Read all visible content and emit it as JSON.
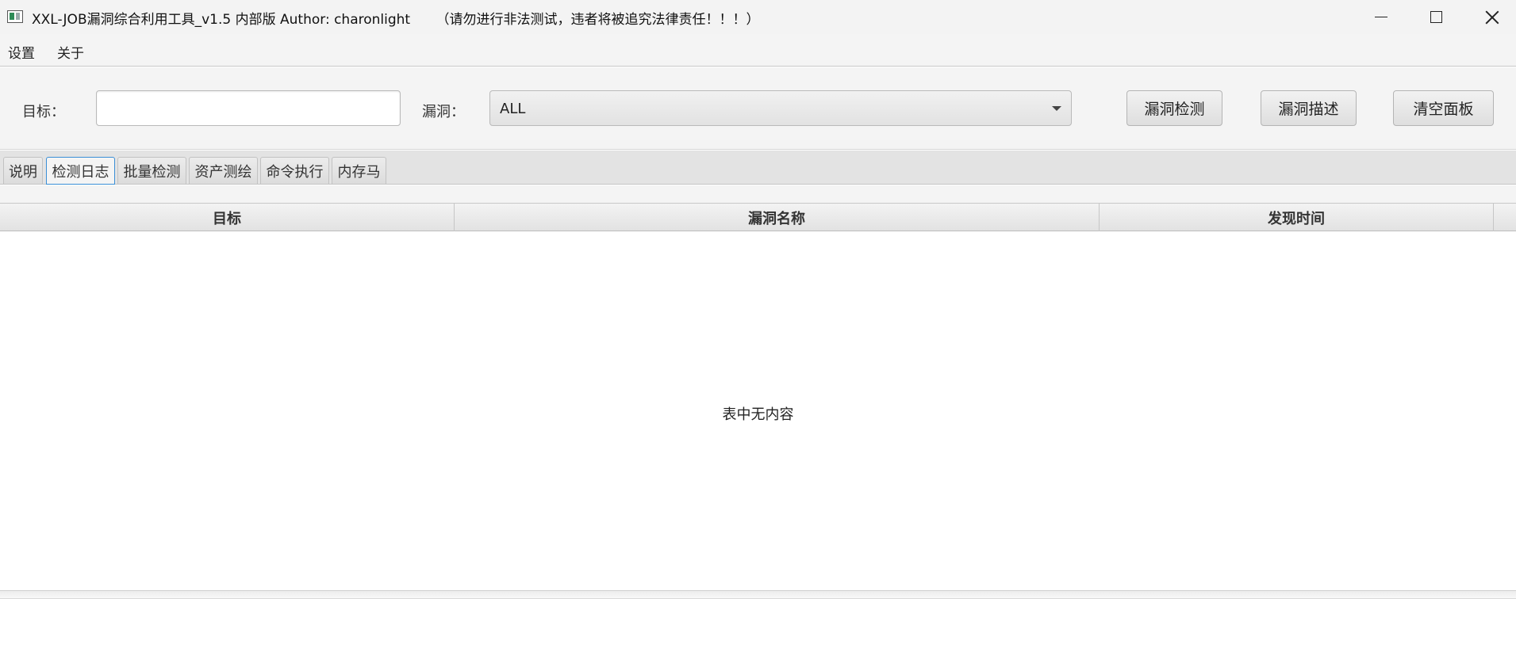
{
  "window": {
    "title": "XXL-JOB漏洞综合利用工具_v1.5 内部版 Author: charonlight      （请勿进行非法测试，违者将被追究法律责任！！！）",
    "icons": [
      "app-icon",
      "minimize-icon",
      "maximize-icon",
      "close-icon"
    ]
  },
  "menu": {
    "settings": "设置",
    "about": "关于"
  },
  "toolbar": {
    "target_label": "目标：",
    "target_value": "",
    "vuln_label": "漏洞：",
    "vuln_selected": "ALL",
    "check_button": "漏洞检测",
    "describe_button": "漏洞描述",
    "clear_button": "清空面板"
  },
  "tabs": [
    {
      "label": "说明",
      "active": false
    },
    {
      "label": "检测日志",
      "active": true
    },
    {
      "label": "批量检测",
      "active": false
    },
    {
      "label": "资产测绘",
      "active": false
    },
    {
      "label": "命令执行",
      "active": false
    },
    {
      "label": "内存马",
      "active": false
    }
  ],
  "table": {
    "columns": [
      "目标",
      "漏洞名称",
      "发现时间"
    ],
    "rows": [],
    "empty_text": "表中无内容"
  },
  "colors": {
    "active_tab_border": "#3b8fd6",
    "background": "#f4f4f4"
  }
}
